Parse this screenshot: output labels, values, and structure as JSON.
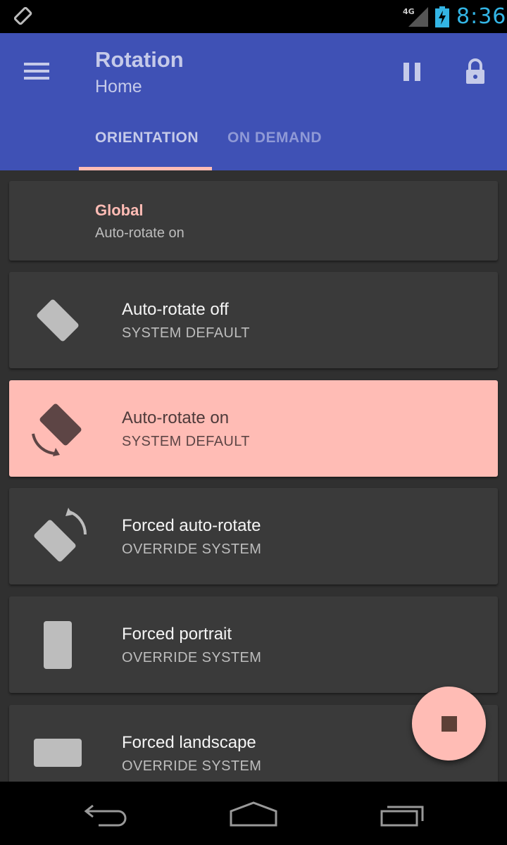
{
  "status_bar": {
    "network": "4G",
    "time": "8:36",
    "time_color": "#33b5e5"
  },
  "app_bar": {
    "title": "Rotation",
    "subtitle": "Home",
    "background": "#3f51b5",
    "actions": [
      "menu-icon",
      "pause-icon",
      "lock-icon"
    ],
    "tabs": [
      {
        "label": "ORIENTATION",
        "selected": true
      },
      {
        "label": "ON DEMAND",
        "selected": false
      }
    ]
  },
  "global": {
    "title": "Global",
    "subtitle": "Auto-rotate on"
  },
  "items": [
    {
      "title": "Auto-rotate off",
      "subtitle": "SYSTEM DEFAULT",
      "icon": "screen-rotation-locked-icon",
      "selected": false
    },
    {
      "title": "Auto-rotate on",
      "subtitle": "SYSTEM DEFAULT",
      "icon": "screen-rotation-icon",
      "selected": true
    },
    {
      "title": "Forced auto-rotate",
      "subtitle": "OVERRIDE SYSTEM",
      "icon": "forced-rotation-icon",
      "selected": false
    },
    {
      "title": "Forced portrait",
      "subtitle": "OVERRIDE SYSTEM",
      "icon": "portrait-icon",
      "selected": false
    },
    {
      "title": "Forced landscape",
      "subtitle": "OVERRIDE SYSTEM",
      "icon": "landscape-icon",
      "selected": false
    }
  ],
  "fab": {
    "icon": "stop-icon",
    "color": "#ffbcb5"
  },
  "nav_bar": {
    "buttons": [
      "back-icon",
      "home-icon",
      "recents-icon"
    ]
  },
  "accent_color": "#ffbcb5"
}
